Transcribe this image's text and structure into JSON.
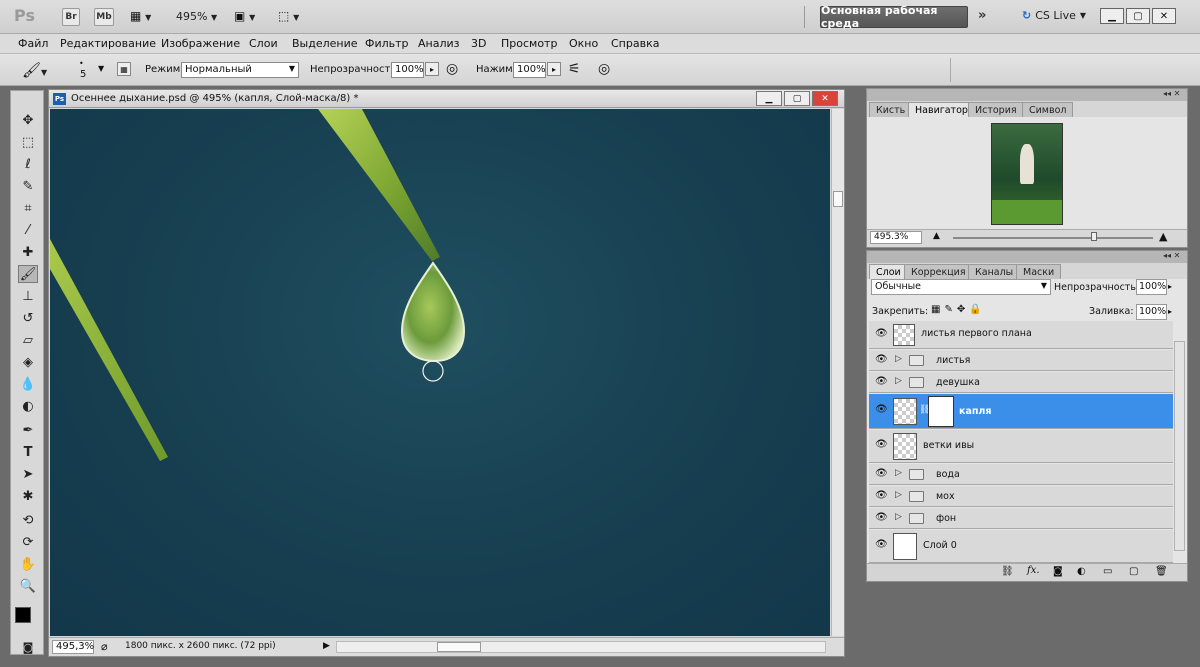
{
  "app": {
    "logo": "Ps",
    "bridge_btn": "Br",
    "minibridge_btn": "Mb",
    "zoom_level": "495%",
    "workspace": "Основная рабочая среда",
    "cs_live": "CS Live"
  },
  "menu": [
    "Файл",
    "Редактирование",
    "Изображение",
    "Слои",
    "Выделение",
    "Фильтр",
    "Анализ",
    "3D",
    "Просмотр",
    "Окно",
    "Справка"
  ],
  "options": {
    "brush_size": "5",
    "mode_label": "Режим:",
    "mode_value": "Нормальный",
    "opacity_label": "Непрозрачность:",
    "opacity_value": "100%",
    "flow_label": "Нажим:",
    "flow_value": "100%"
  },
  "document": {
    "title": "Осеннее дыхание.psd @ 495% (капля, Слой-маска/8) *",
    "zoom": "495,3%",
    "info": "1800 пикс. x 2600 пикс. (72 ppi)"
  },
  "navigator": {
    "tabs": [
      "Кисть",
      "Навигатор",
      "История",
      "Символ"
    ],
    "active_tab": 1,
    "zoom": "495.3%"
  },
  "layers": {
    "tabs": [
      "Слои",
      "Коррекция",
      "Каналы",
      "Маски"
    ],
    "active_tab": 0,
    "blend_mode": "Обычные",
    "opacity_label": "Непрозрачность:",
    "opacity_value": "100%",
    "lock_label": "Закрепить:",
    "fill_label": "Заливка:",
    "fill_value": "100%",
    "items": [
      {
        "name": "листья первого плана",
        "type": "layer",
        "selected": false
      },
      {
        "name": "листья",
        "type": "group",
        "selected": false
      },
      {
        "name": "девушка",
        "type": "group",
        "selected": false
      },
      {
        "name": "капля",
        "type": "layer-mask",
        "selected": true
      },
      {
        "name": "ветки ивы",
        "type": "layer",
        "selected": false
      },
      {
        "name": "вода",
        "type": "group",
        "selected": false
      },
      {
        "name": "мох",
        "type": "group",
        "selected": false
      },
      {
        "name": "фон",
        "type": "group",
        "selected": false
      },
      {
        "name": "Слой 0",
        "type": "layer-white",
        "selected": false
      }
    ]
  }
}
